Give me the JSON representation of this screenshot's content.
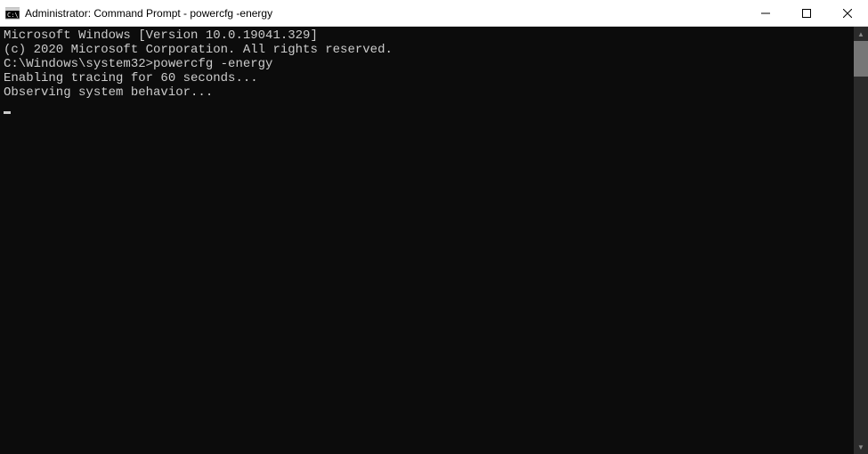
{
  "window": {
    "title": "Administrator: Command Prompt - powercfg  -energy"
  },
  "terminal": {
    "lines": [
      "Microsoft Windows [Version 10.0.19041.329]",
      "(c) 2020 Microsoft Corporation. All rights reserved.",
      "",
      "C:\\Windows\\system32>powercfg -energy",
      "Enabling tracing for 60 seconds...",
      "Observing system behavior..."
    ],
    "prompt": "C:\\Windows\\system32>",
    "command": "powercfg -energy"
  }
}
